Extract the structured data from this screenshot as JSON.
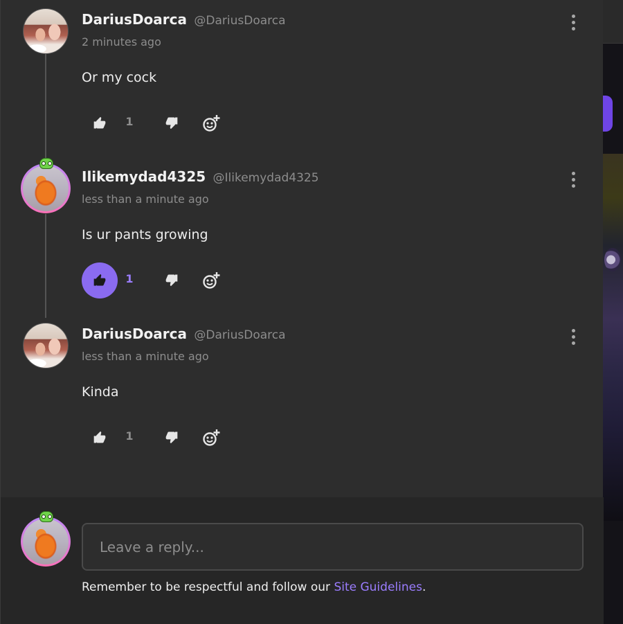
{
  "comments": [
    {
      "name": "DariusDoarca",
      "handle": "@DariusDoarca",
      "time": "2 minutes ago",
      "text": "Or my cock",
      "likes": "1",
      "liked": false
    },
    {
      "name": "Ilikemydad4325",
      "handle": "@Ilikemydad4325",
      "time": "less than a minute ago",
      "text": "Is ur pants growing",
      "likes": "1",
      "liked": true
    },
    {
      "name": "DariusDoarca",
      "handle": "@DariusDoarca",
      "time": "less than a minute ago",
      "text": "Kinda",
      "likes": "1",
      "liked": false
    }
  ],
  "reply": {
    "placeholder": "Leave a reply...",
    "guidelines_prefix": "Remember to be respectful and follow our ",
    "guidelines_link": "Site Guidelines",
    "guidelines_suffix": "."
  },
  "colors": {
    "panel": "#2d2d2d",
    "accent": "#8a6bf0",
    "accent_text": "#9b7dff",
    "muted": "#8d8d8d"
  },
  "icons": [
    "more-vertical-icon",
    "thumbs-up-icon",
    "thumbs-down-icon",
    "add-reaction-icon",
    "frog-badge-icon"
  ]
}
